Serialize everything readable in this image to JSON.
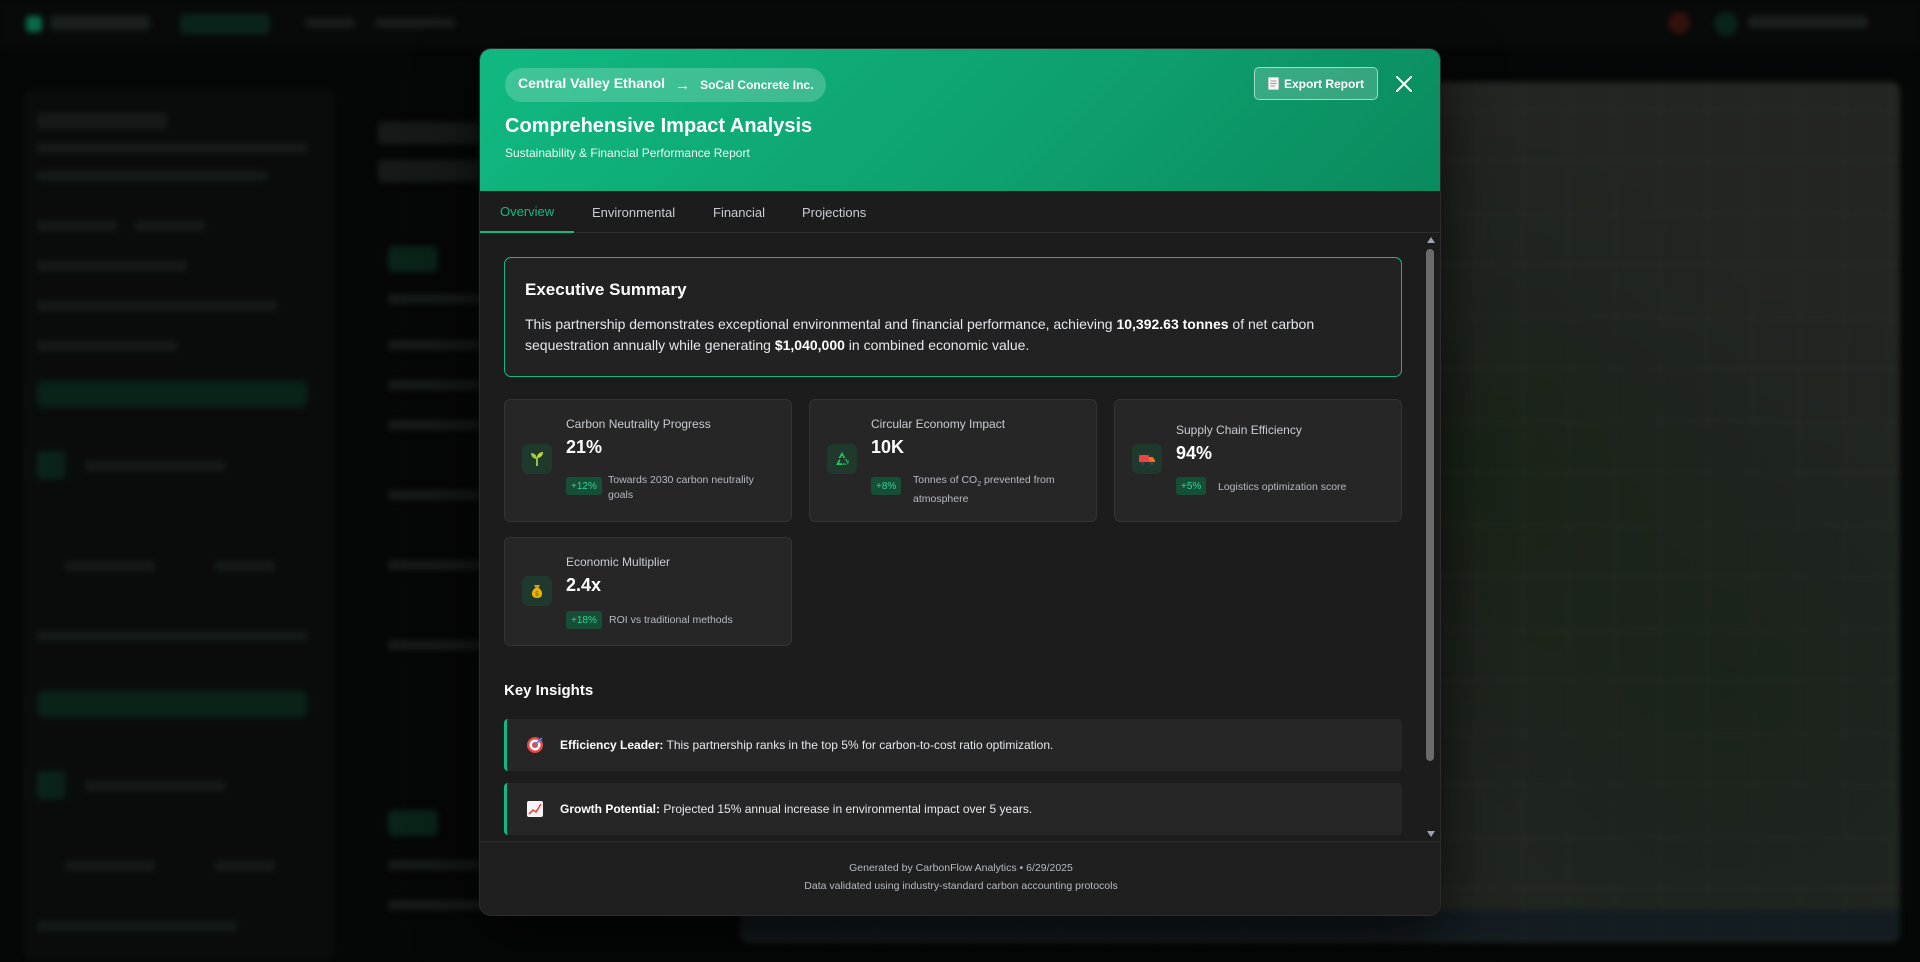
{
  "modal": {
    "route": {
      "from": "Central Valley Ethanol",
      "arrow": "→",
      "to": "SoCal Concrete Inc."
    },
    "title": "Comprehensive Impact Analysis",
    "subtitle": "Sustainability & Financial Performance Report",
    "export_label": "Export Report",
    "export_icon": "document-icon",
    "close_icon": "close-icon"
  },
  "tabs": [
    {
      "label": "Overview",
      "active": true
    },
    {
      "label": "Environmental",
      "active": false
    },
    {
      "label": "Financial",
      "active": false
    },
    {
      "label": "Projections",
      "active": false
    }
  ],
  "executive_summary": {
    "title": "Executive Summary",
    "text_1": "This partnership demonstrates exceptional environmental and financial performance, achieving ",
    "highlight_1": "10,392.63 tonnes",
    "text_2": " of net carbon sequestration annually while generating ",
    "highlight_2": "$1,040,000",
    "text_3": " in combined economic value."
  },
  "metrics": [
    {
      "label": "Carbon Neutrality Progress",
      "value": "21%",
      "change": "+12%",
      "description": "Towards 2030 carbon neutrality goals",
      "icon": "seedling-icon"
    },
    {
      "label": "Circular Economy Impact",
      "value": "10K",
      "change": "+8%",
      "description_pre": "Tonnes of CO",
      "description_sub": "2",
      "description_post": " prevented from atmosphere",
      "icon": "recycle-icon"
    },
    {
      "label": "Supply Chain Efficiency",
      "value": "94%",
      "change": "+5%",
      "description": "Logistics optimization score",
      "icon": "truck-icon"
    },
    {
      "label": "Economic Multiplier",
      "value": "2.4x",
      "change": "+18%",
      "description": "ROI vs traditional methods",
      "icon": "money-bag-icon"
    }
  ],
  "key_insights": {
    "title": "Key Insights",
    "items": [
      {
        "title": "Efficiency Leader:",
        "text": " This partnership ranks in the top 5% for carbon-to-cost ratio optimization.",
        "icon": "target-icon"
      },
      {
        "title": "Growth Potential:",
        "text": " Projected 15% annual increase in environmental impact over 5 years.",
        "icon": "chart-increasing-icon"
      }
    ]
  },
  "footer": {
    "line_1": "Generated by CarbonFlow Analytics • 6/29/2025",
    "line_2": "Data validated using industry-standard carbon accounting protocols"
  },
  "colors": {
    "accent": "#10b981",
    "modal_bg": "#1c1c1c",
    "card_bg": "#262626",
    "badge_bg": "#164e36",
    "badge_text": "#34d399"
  }
}
